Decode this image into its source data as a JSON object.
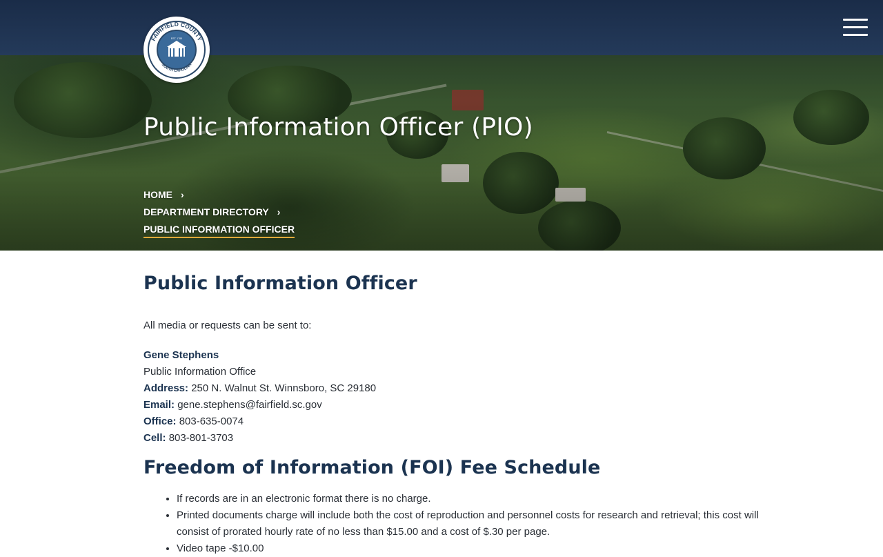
{
  "header": {
    "logo_text_top": "FAIRFIELD COUNTY",
    "logo_text_bottom": "SOUTH CAROLINA",
    "logo_est": "EST. 1785",
    "menu_icon": "hamburger-menu-icon"
  },
  "hero": {
    "title": "Public Information Officer (PIO)"
  },
  "breadcrumb": {
    "items": [
      {
        "label": "HOME"
      },
      {
        "label": "DEPARTMENT DIRECTORY"
      },
      {
        "label": "PUBLIC INFORMATION OFFICER"
      }
    ],
    "chevron_icon": "chevron-right-icon"
  },
  "main": {
    "heading": "Public Information Officer",
    "intro": "All media or requests can be sent to:",
    "contact": {
      "name": "Gene Stephens",
      "office_name": "Public Information Office",
      "address_label": "Address:",
      "address": "250 N. Walnut St. Winnsboro, SC 29180",
      "email_label": "Email:",
      "email": "gene.stephens@fairfield.sc.gov",
      "office_label": "Office:",
      "office_phone": "803-635-0074",
      "cell_label": "Cell:",
      "cell_phone": "803-801-3703"
    },
    "foi_heading": "Freedom of Information (FOI) Fee Schedule",
    "foi_items": [
      "If records are in an electronic format there is no charge.",
      "Printed documents charge will include both the cost of reproduction and personnel costs for research and retrieval; this cost will consist of prorated hourly rate of no less than $15.00 and a cost of $.30 per page.",
      "Video tape -$10.00"
    ]
  },
  "colors": {
    "header_bg": "#1a2c48",
    "heading": "#1b3350",
    "breadcrumb_underline": "#e0a93a"
  }
}
